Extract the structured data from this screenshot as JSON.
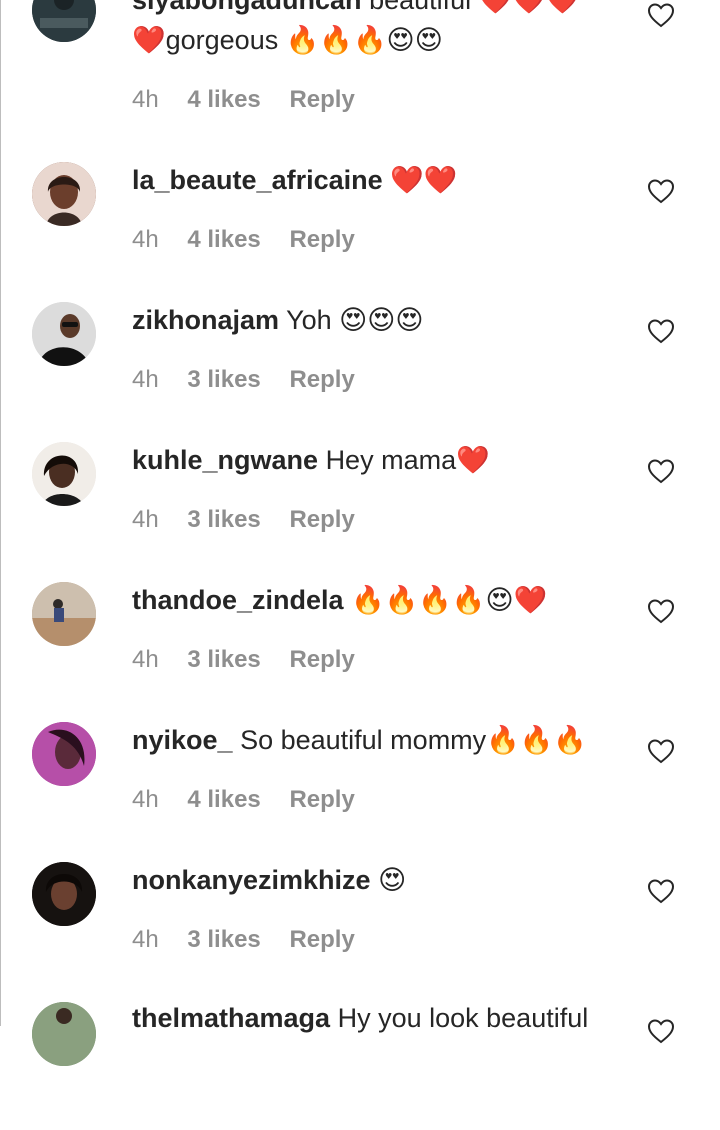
{
  "comments": [
    {
      "user": "siyabongaduncan",
      "text": "beautiful ❤️❤️❤️",
      "text2": "❤️gorgeous 🔥🔥🔥😍😍",
      "time": "4h",
      "likes": "4 likes",
      "reply": "Reply",
      "avatar_color": "#2b3a3f"
    },
    {
      "user": "la_beaute_africaine",
      "text": "❤️❤️",
      "time": "4h",
      "likes": "4 likes",
      "reply": "Reply",
      "avatar_color": "#7a4a3a"
    },
    {
      "user": "zikhonajam",
      "text": "Yoh 😍😍😍",
      "time": "4h",
      "likes": "3 likes",
      "reply": "Reply",
      "avatar_color": "#d7d7d7"
    },
    {
      "user": "kuhle_ngwane",
      "text": "Hey mama❤️",
      "time": "4h",
      "likes": "3 likes",
      "reply": "Reply",
      "avatar_color": "#e8e4e0"
    },
    {
      "user": "thandoe_zindela",
      "text": "🔥🔥🔥🔥😍❤️",
      "time": "4h",
      "likes": "3 likes",
      "reply": "Reply",
      "avatar_color": "#b79a7a"
    },
    {
      "user": "nyikoe_",
      "text": "So beautiful mommy🔥🔥🔥",
      "time": "4h",
      "likes": "4 likes",
      "reply": "Reply",
      "avatar_color": "#9b3f8f"
    },
    {
      "user": "nonkanyezimkhize",
      "text": "😍",
      "time": "4h",
      "likes": "3 likes",
      "reply": "Reply",
      "avatar_color": "#1e1a18"
    },
    {
      "user": "thelmathamaga",
      "text": "Hy you look beautiful",
      "avatar_color": "#6f8a6a"
    }
  ]
}
